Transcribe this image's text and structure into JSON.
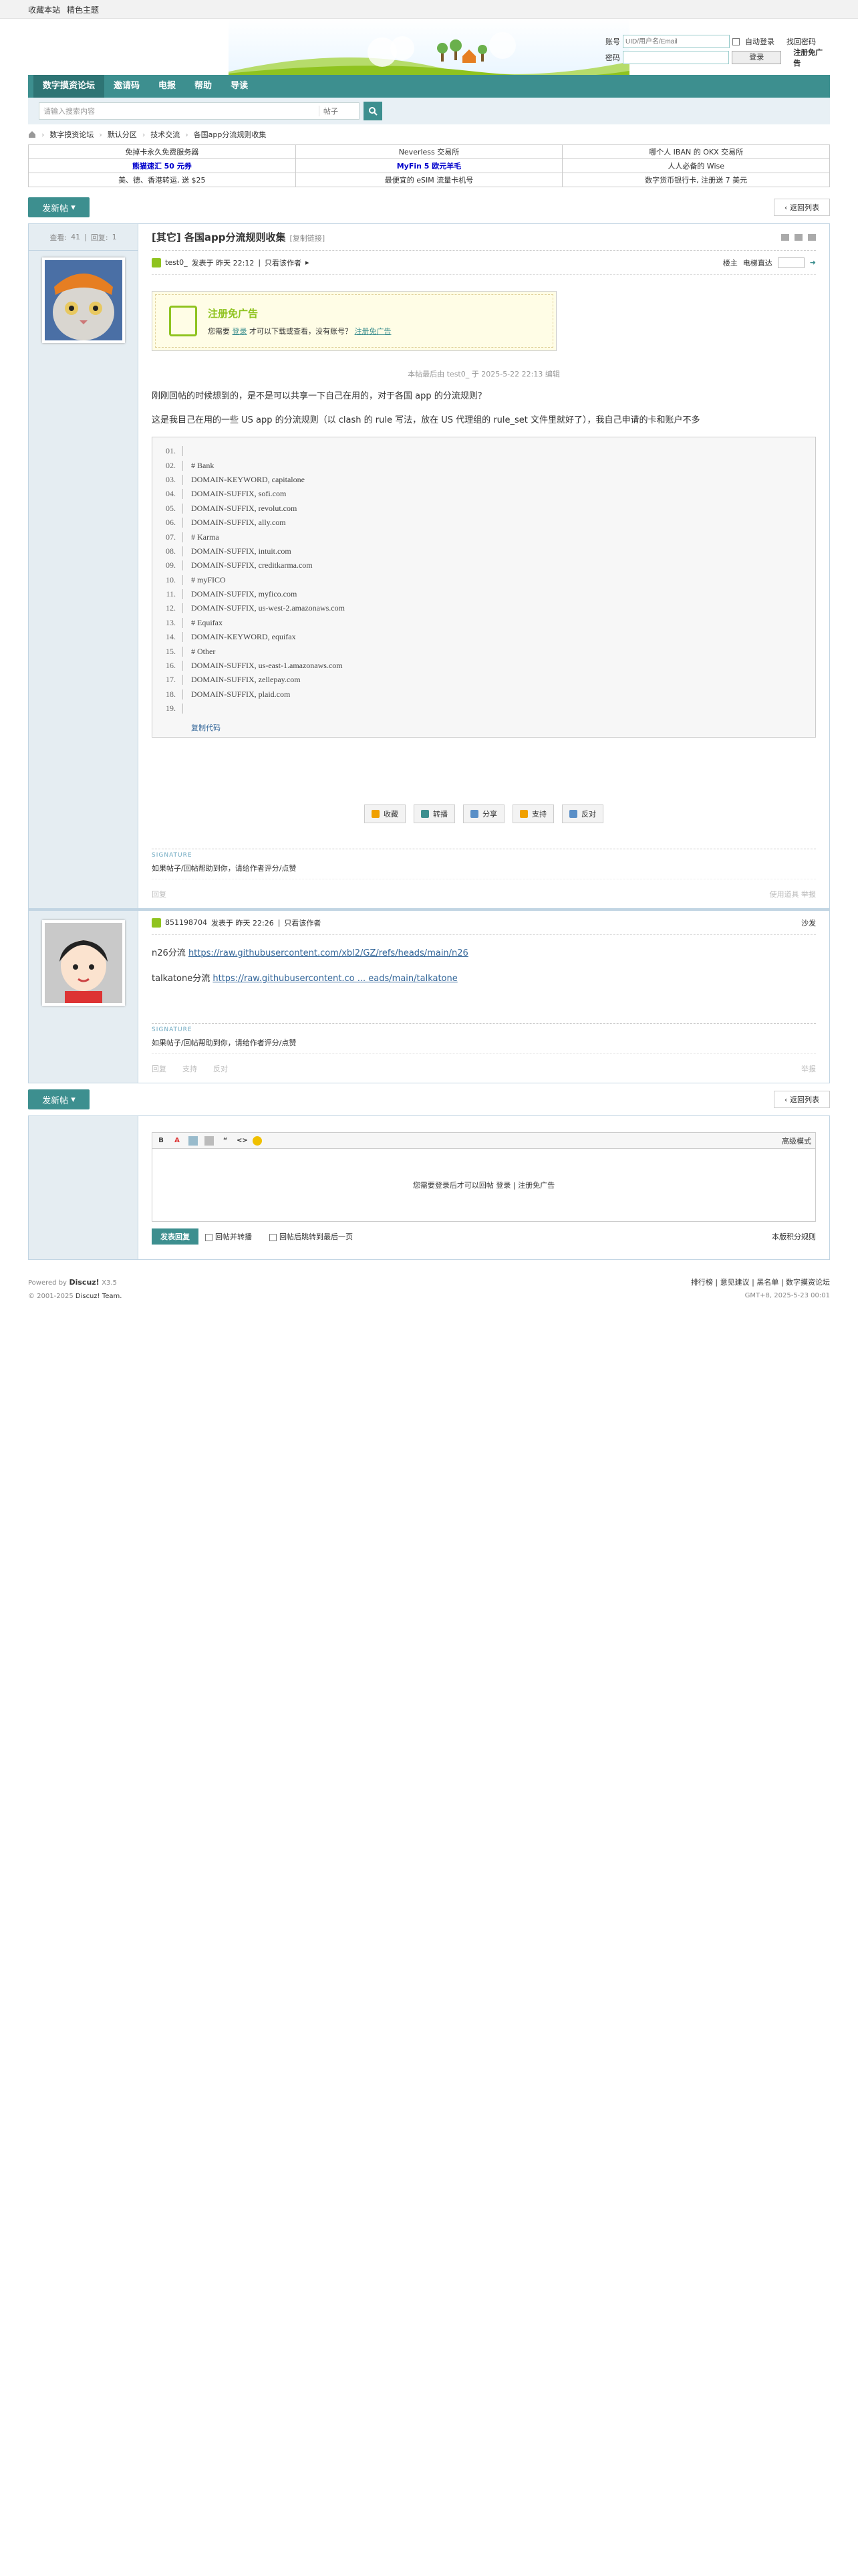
{
  "topbar": {
    "favorite": "收藏本站",
    "theme": "精色主题"
  },
  "login": {
    "account_label": "账号",
    "account_placeholder": "UID/用户名/Email",
    "auto_login": "自动登录",
    "forgot": "找回密码",
    "password_label": "密码",
    "login_btn": "登录",
    "register": "注册免广告"
  },
  "nav": [
    "数字摸资论坛",
    "邀请码",
    "电报",
    "帮助",
    "导读"
  ],
  "search": {
    "placeholder": "请输入搜索内容",
    "scope": "帖子"
  },
  "breadcrumb": [
    "数字摸资论坛",
    "默认分区",
    "技术交流",
    "各国app分流规则收集"
  ],
  "ads": [
    [
      "免掉卡永久免费服务器",
      "Neverless 交易所",
      "哪个人 IBAN 的 OKX 交易所"
    ],
    [
      "熊猫速汇 50 元券",
      "MyFin 5 欧元羊毛",
      "人人必备的 Wise"
    ],
    [
      "美、德、香港转运, 送 $25",
      "最便宜的 eSIM 流量卡机号",
      "数字货币银行卡, 注册送 7 美元"
    ]
  ],
  "new_post": "发新帖",
  "back_list": "返回列表",
  "stats": {
    "views_label": "查看:",
    "views": "41",
    "replies_label": "回复:",
    "replies": "1"
  },
  "thread": {
    "title": "[其它] 各国app分流规则收集",
    "copy": "[复制链接]"
  },
  "post1": {
    "author": "test0_",
    "time": "发表于 昨天 22:12",
    "only_author": "只看该作者",
    "floor": "楼主",
    "jump": "电梯直达",
    "reg_title": "注册免广告",
    "reg_text_1": "您需要",
    "reg_login": "登录",
    "reg_text_2": "才可以下载或查看，没有账号？",
    "reg_link": "注册免广告",
    "edited": "本帖最后由 test0_ 于 2025-5-22 22:13 编辑",
    "para1": "刚刚回帖的时候想到的，是不是可以共享一下自己在用的，对于各国 app 的分流规则？",
    "para2": "这是我目己在用的一些 US app 的分流规则（以 clash 的 rule 写法，放在 US 代理组的 rule_set 文件里就好了），我自己申请的卡和账户不多",
    "code": [
      {
        "n": "01.",
        "t": ""
      },
      {
        "n": "02.",
        "t": "# Bank"
      },
      {
        "n": "03.",
        "t": "DOMAIN-KEYWORD, capitalone"
      },
      {
        "n": "04.",
        "t": "DOMAIN-SUFFIX, sofi.com"
      },
      {
        "n": "05.",
        "t": "DOMAIN-SUFFIX, revolut.com"
      },
      {
        "n": "06.",
        "t": "DOMAIN-SUFFIX, ally.com"
      },
      {
        "n": "07.",
        "t": "# Karma"
      },
      {
        "n": "08.",
        "t": "DOMAIN-SUFFIX, intuit.com"
      },
      {
        "n": "09.",
        "t": "DOMAIN-SUFFIX, creditkarma.com"
      },
      {
        "n": "10.",
        "t": "# myFICO"
      },
      {
        "n": "11.",
        "t": "DOMAIN-SUFFIX, myfico.com"
      },
      {
        "n": "12.",
        "t": "DOMAIN-SUFFIX, us-west-2.amazonaws.com"
      },
      {
        "n": "13.",
        "t": "# Equifax"
      },
      {
        "n": "14.",
        "t": "DOMAIN-KEYWORD, equifax"
      },
      {
        "n": "15.",
        "t": "# Other"
      },
      {
        "n": "16.",
        "t": "DOMAIN-SUFFIX, us-east-1.amazonaws.com"
      },
      {
        "n": "17.",
        "t": "DOMAIN-SUFFIX, zellepay.com"
      },
      {
        "n": "18.",
        "t": "DOMAIN-SUFFIX, plaid.com"
      },
      {
        "n": "19.",
        "t": ""
      }
    ],
    "copy_code": "复制代码",
    "actions": [
      "收藏",
      "转播",
      "分享",
      "支持",
      "反对"
    ],
    "sig_head": "SIGNATURE",
    "sig": "如果帖子/回帖帮助到你，请给作者评分/点赞",
    "reply": "回复",
    "foot_right": "使用道具  举报"
  },
  "post2": {
    "author": "851198704",
    "time": "发表于 昨天 22:26",
    "only_author": "只看该作者",
    "floor": "沙发",
    "line1_label": "n26分流",
    "line1_link": "https://raw.githubusercontent.com/xbl2/GZ/refs/heads/main/n26",
    "line2_label": "talkatone分流",
    "line2_link": "https://raw.githubusercontent.co ... eads/main/talkatone",
    "sig_head": "SIGNATURE",
    "sig": "如果帖子/回帖帮助到你，请给作者评分/点赞",
    "foot": [
      "回复",
      "支持",
      "反对"
    ],
    "report": "举报"
  },
  "editor": {
    "advanced": "高级模式",
    "need_login": "您需要登录后才可以回帖",
    "login": "登录",
    "register": "注册免广告",
    "reply_btn": "发表回复",
    "opt1": "回帖并转播",
    "opt2": "回帖后跳转到最后一页",
    "rules": "本版积分规则"
  },
  "footer": {
    "powered": "Powered by",
    "brand": "Discuz!",
    "version": "X3.5",
    "copyright": "© 2001-2025",
    "team": "Discuz! Team.",
    "links": "排行榜 | 意见建议 | 黑名单 | 数字摸资论坛",
    "time": "GMT+8, 2025-5-23 00:01"
  }
}
